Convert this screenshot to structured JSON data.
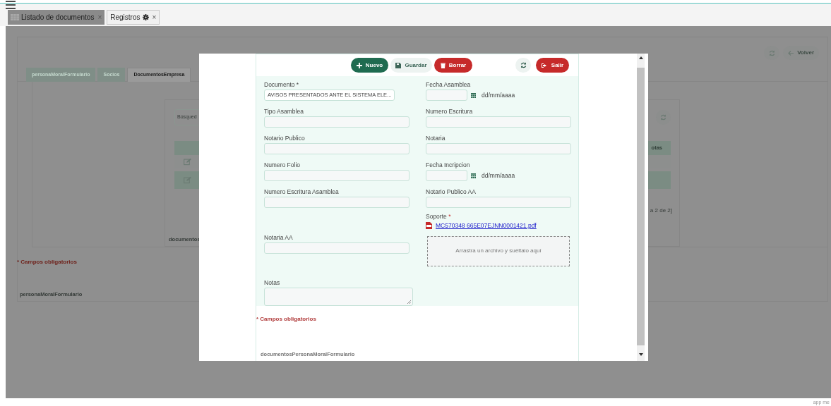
{
  "tabs": [
    {
      "label": "Listado de documentos",
      "close": "×",
      "selected": false
    },
    {
      "label": "Registros",
      "close": "×",
      "selected": true
    }
  ],
  "background": {
    "actions": [
      {
        "kind": "refresh"
      },
      {
        "kind": "back",
        "label": "Volver"
      }
    ],
    "form_tabs": [
      {
        "label": "personaMoralFormulario",
        "selected": false
      },
      {
        "label": "Socios",
        "selected": false
      },
      {
        "label": "DocumentosEmpresa",
        "selected": true
      }
    ],
    "search": {
      "placeholder": "Búsqued"
    },
    "table": {
      "column_header": "otas",
      "rows": [
        {
          "selected": false
        },
        {
          "selected": true
        }
      ]
    },
    "pagination": "a 2 de 2]",
    "panel_label": "documentos",
    "required_note": "* Campos obligatorios",
    "form_label": "personaMoralFormulario"
  },
  "modal": {
    "toolbar": [
      {
        "kind": "new",
        "label": "Nuevo"
      },
      {
        "kind": "save",
        "label": "Guardar"
      },
      {
        "kind": "delete",
        "label": "Borrar"
      },
      {
        "kind": "refresh"
      },
      {
        "kind": "exit",
        "label": "Salir"
      }
    ],
    "rows": [
      {
        "left": {
          "kind": "select",
          "label": "Documento",
          "required_mark": "*",
          "value": "AVISOS PRESENTADOS ANTE EL SISTEMA ELE..."
        },
        "right": {
          "kind": "date",
          "label": "Fecha Asamblea",
          "format_hint": "dd/mm/aaaa"
        }
      },
      {
        "left": {
          "kind": "text",
          "label": "Tipo Asamblea"
        },
        "right": {
          "kind": "text",
          "label": "Numero Escritura"
        }
      },
      {
        "left": {
          "kind": "text",
          "label": "Notario Publico"
        },
        "right": {
          "kind": "text",
          "label": "Notaria"
        }
      },
      {
        "left": {
          "kind": "text",
          "label": "Numero Folio"
        },
        "right": {
          "kind": "date",
          "label": "Fecha Incripcion",
          "format_hint": "dd/mm/aaaa"
        }
      },
      {
        "left": {
          "kind": "text",
          "label": "Numero Escritura Asamblea"
        },
        "right": {
          "kind": "text",
          "label": "Notario Publico AA"
        }
      },
      {
        "left": {
          "kind": "text",
          "label": "Notaria AA"
        },
        "right": {
          "kind": "file",
          "label": "Soporte",
          "required_mark": "*",
          "file_name": "MC570348 665E07EJNN0001421.pdf",
          "drop_hint": "Arrastra un archivo y suéltalo aquí"
        }
      },
      {
        "left": {
          "kind": "textarea",
          "label": "Notas"
        }
      }
    ],
    "required_note": "* Campos obligatorios",
    "form_label": "documentosPersonaMoralFormulario"
  },
  "footer": "app me"
}
